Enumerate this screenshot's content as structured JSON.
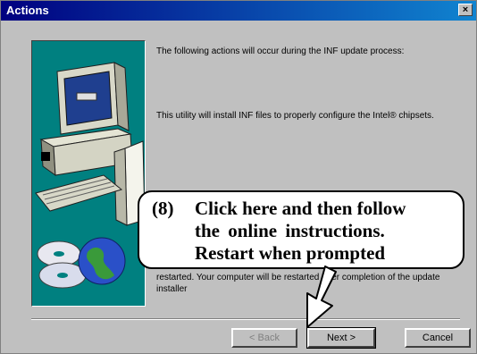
{
  "window": {
    "title": "Actions",
    "close_label": "×"
  },
  "messages": [
    "The following actions will occur during the INF update process:",
    "This utility will install INF files to properly configure the Intel® chipsets.",
    "restarted. Your computer will be restarted after completion of the update installer"
  ],
  "callout": {
    "number": "(8)",
    "line1": "Click here and then follow",
    "line2": "the online instructions.",
    "line3": "Restart when prompted"
  },
  "buttons": {
    "back": "< Back",
    "next": "Next >",
    "cancel": "Cancel"
  }
}
